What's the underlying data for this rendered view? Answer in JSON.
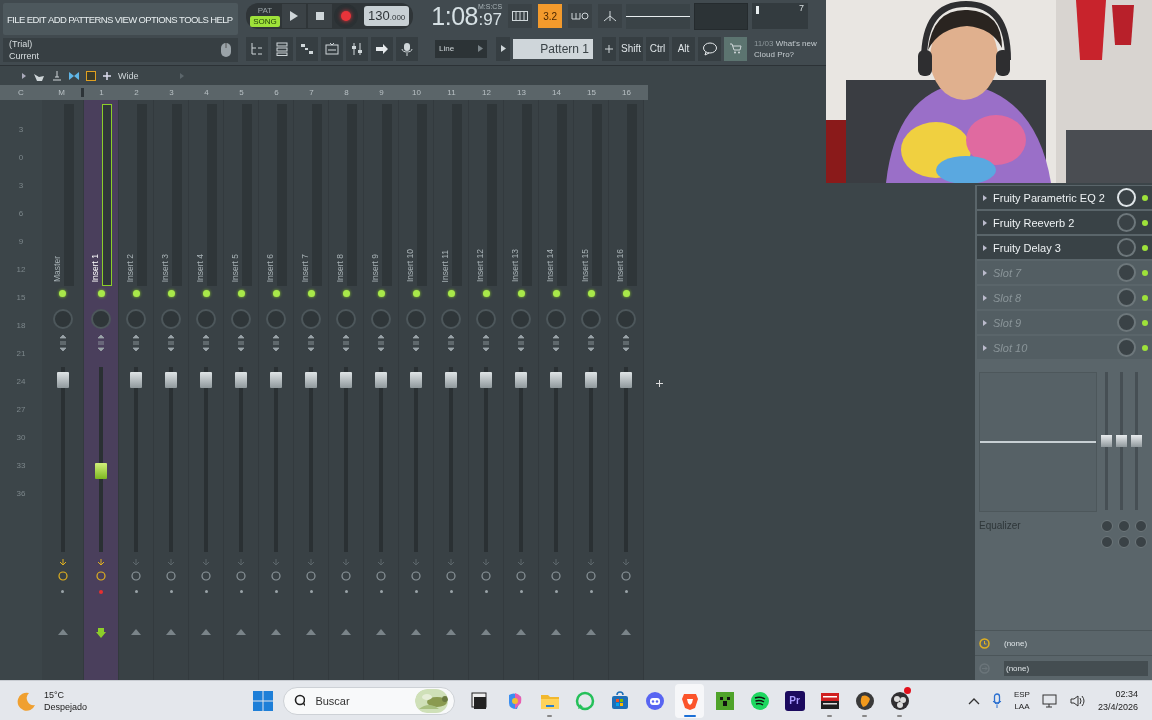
{
  "menu": [
    "FILE",
    "EDIT",
    "ADD",
    "PATTERNS",
    "VIEW",
    "OPTIONS",
    "TOOLS",
    "HELP"
  ],
  "hint": {
    "line_1": "(Trial)",
    "line_2": "Current"
  },
  "transport": {
    "modes": [
      {
        "label": "PAT",
        "selected": false
      },
      {
        "label": "SONG",
        "selected": true
      }
    ],
    "recording": true,
    "tempo": "130",
    "tempo_fraction": ".000"
  },
  "clock": {
    "time": "1:08",
    "centiseconds": ":97",
    "unit": "M:S:CS"
  },
  "toggles": [
    {
      "kind": "keyboard",
      "on": false
    },
    {
      "kind": "countdown",
      "label": "3.2",
      "on": true
    },
    {
      "kind": "blend",
      "on": false
    },
    {
      "kind": "metronome",
      "on": false
    }
  ],
  "cpu": {
    "value": "7"
  },
  "snap": "Line",
  "pattern": "Pattern 1",
  "modifier_keys": [
    "Shift",
    "Ctrl",
    "Alt"
  ],
  "news": {
    "date": "11/03",
    "headline": "What's new",
    "line_2": "Cloud Pro?"
  },
  "mixer": {
    "stereo_label": "Wide",
    "columns": [
      "C",
      "M",
      "1",
      "2",
      "3",
      "4",
      "5",
      "6",
      "7",
      "8",
      "9",
      "10",
      "11",
      "12",
      "13",
      "14",
      "15",
      "16"
    ],
    "scale": [
      "3",
      "0",
      "3",
      "6",
      "9",
      "12",
      "15",
      "18",
      "21",
      "24",
      "27",
      "30",
      "33",
      "36"
    ],
    "tracks": [
      {
        "name": "Master",
        "selected": false,
        "level": 0.93,
        "fx_active": true
      },
      {
        "name": "Insert 1",
        "selected": true,
        "level": 0.44,
        "fx_active": true
      },
      {
        "name": "Insert 2",
        "selected": false,
        "level": 0.93,
        "fx_active": false
      },
      {
        "name": "Insert 3",
        "selected": false,
        "level": 0.93,
        "fx_active": false
      },
      {
        "name": "Insert 4",
        "selected": false,
        "level": 0.93,
        "fx_active": false
      },
      {
        "name": "Insert 5",
        "selected": false,
        "level": 0.93,
        "fx_active": false
      },
      {
        "name": "Insert 6",
        "selected": false,
        "level": 0.93,
        "fx_active": false
      },
      {
        "name": "Insert 7",
        "selected": false,
        "level": 0.93,
        "fx_active": false
      },
      {
        "name": "Insert 8",
        "selected": false,
        "level": 0.93,
        "fx_active": false
      },
      {
        "name": "Insert 9",
        "selected": false,
        "level": 0.93,
        "fx_active": false
      },
      {
        "name": "Insert 10",
        "selected": false,
        "level": 0.93,
        "fx_active": false
      },
      {
        "name": "Insert 11",
        "selected": false,
        "level": 0.93,
        "fx_active": false
      },
      {
        "name": "Insert 12",
        "selected": false,
        "level": 0.93,
        "fx_active": false
      },
      {
        "name": "Insert 13",
        "selected": false,
        "level": 0.93,
        "fx_active": false
      },
      {
        "name": "Insert 14",
        "selected": false,
        "level": 0.93,
        "fx_active": false
      },
      {
        "name": "Insert 15",
        "selected": false,
        "level": 0.93,
        "fx_active": false
      },
      {
        "name": "Insert 16",
        "selected": false,
        "level": 0.93,
        "fx_active": false
      }
    ]
  },
  "fx_panel": {
    "slots": [
      {
        "name": "Fruity Parametric EQ 2",
        "kind": "plugin"
      },
      {
        "name": "Fruity Reeverb 2",
        "kind": "plugin"
      },
      {
        "name": "Fruity Delay 3",
        "kind": "plugin"
      },
      {
        "name": "Slot 7",
        "kind": "empty"
      },
      {
        "name": "Slot 8",
        "kind": "empty"
      },
      {
        "name": "Slot 9",
        "kind": "empty"
      },
      {
        "name": "Slot 10",
        "kind": "empty"
      }
    ],
    "eq_bands": [
      {
        "level": 0.5
      },
      {
        "level": 0.5
      },
      {
        "level": 0.5
      }
    ],
    "equalizer_label": "Equalizer",
    "input": "(none)",
    "output": "(none)"
  },
  "webcam": {
    "kind": "picture"
  },
  "taskbar": {
    "weather": {
      "temperature": "15°C",
      "condition": "Despejado"
    },
    "search_placeholder": "Buscar",
    "apps": [
      {
        "kind": "task-view",
        "running": false,
        "selected": false,
        "notification": false
      },
      {
        "kind": "copilot",
        "running": false,
        "selected": false,
        "notification": false
      },
      {
        "kind": "folder",
        "running": true,
        "selected": false,
        "notification": false
      },
      {
        "kind": "whatsapp",
        "running": false,
        "selected": false,
        "notification": false
      },
      {
        "kind": "store",
        "running": false,
        "selected": false,
        "notification": false
      },
      {
        "kind": "discord",
        "running": false,
        "selected": false,
        "notification": false
      },
      {
        "kind": "brave",
        "running": true,
        "selected": true,
        "notification": false
      },
      {
        "kind": "minecraft",
        "running": false,
        "selected": false,
        "notification": false
      },
      {
        "kind": "spotify",
        "running": false,
        "selected": false,
        "notification": false
      },
      {
        "kind": "premiere",
        "label": "Pr",
        "running": false,
        "selected": false,
        "notification": false
      },
      {
        "kind": "voicemeeter",
        "running": true,
        "selected": false,
        "notification": false
      },
      {
        "kind": "fl",
        "running": true,
        "selected": false,
        "notification": false
      },
      {
        "kind": "obs",
        "running": true,
        "selected": false,
        "notification": true
      }
    ],
    "language": [
      "ESP",
      "LAA"
    ],
    "time": "02:34",
    "date": "23/4/2026"
  }
}
